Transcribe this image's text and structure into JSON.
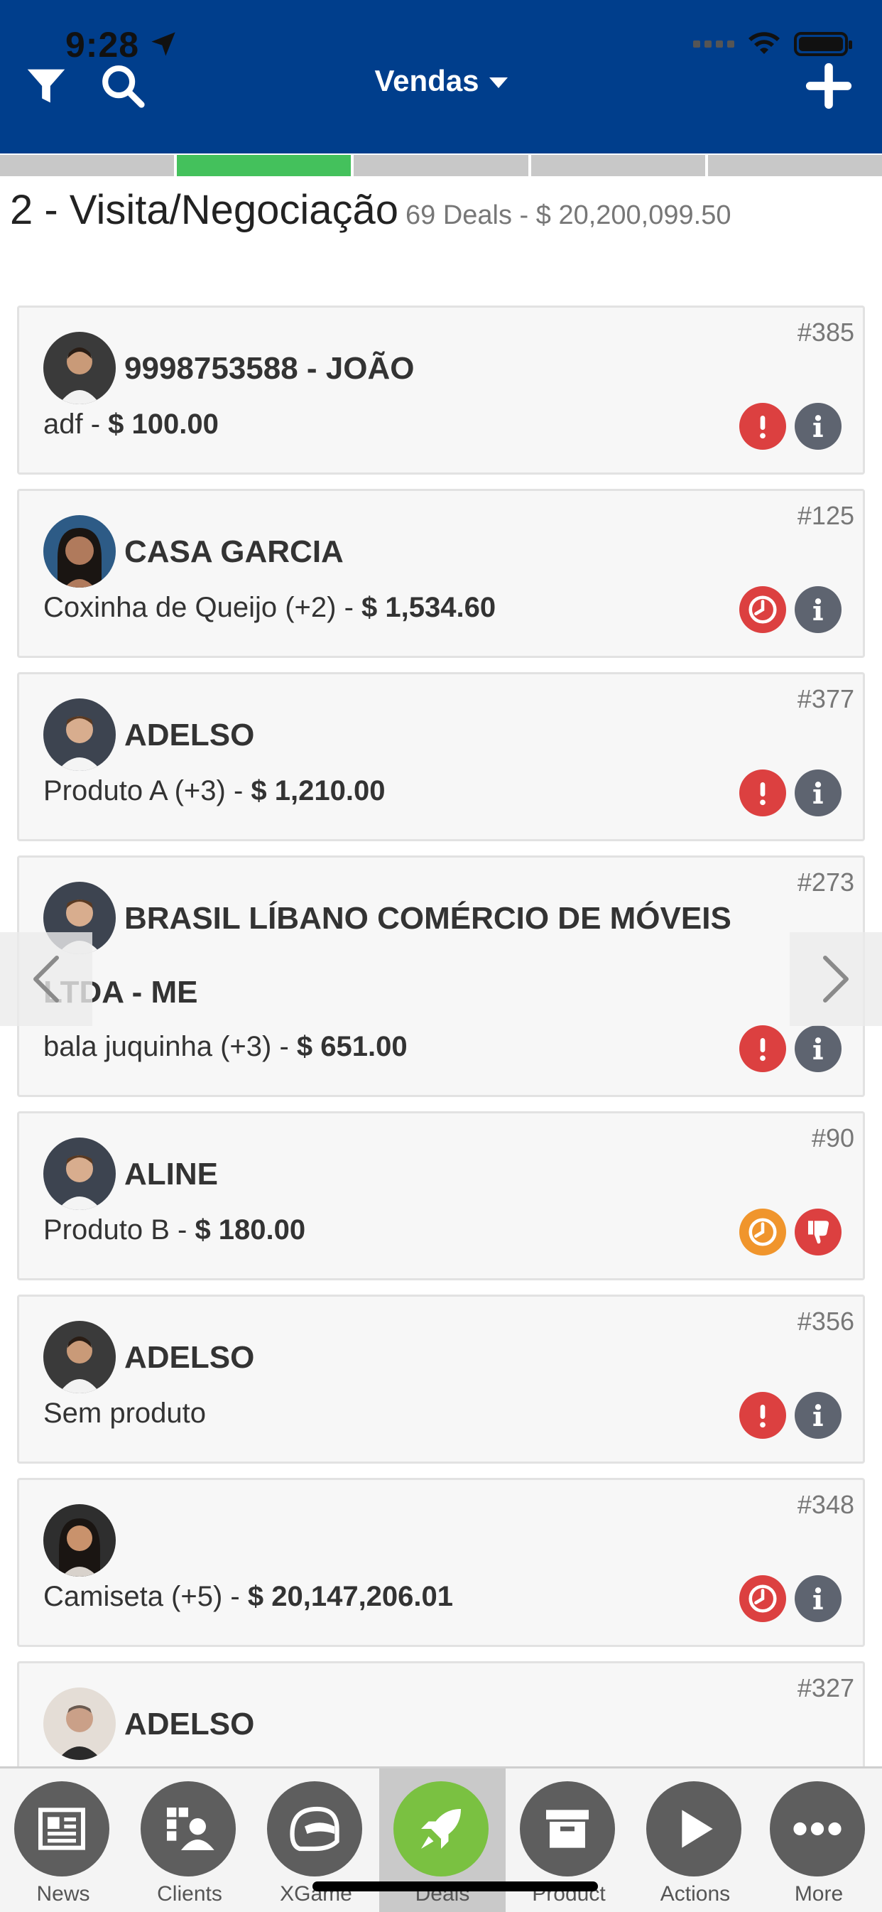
{
  "status_bar": {
    "time": "9:28"
  },
  "header": {
    "title": "Vendas",
    "colors": {
      "background": "#003e8c",
      "text": "#ffffff"
    }
  },
  "stages": {
    "count": 5,
    "active_index": 1,
    "active_color": "#44c15c"
  },
  "stage_header": {
    "title": "2 - Visita/Negociação",
    "summary": "69 Deals - $ 20,200,099.50"
  },
  "deals": [
    {
      "number": "#385",
      "client": "9998753588 - JOÃO",
      "product": "adf - ",
      "amount": "$ 100.00",
      "status_icons": [
        "alert-icon",
        "info-icon"
      ]
    },
    {
      "number": "#125",
      "client": "CASA GARCIA",
      "product": "Coxinha de Queijo (+2) - ",
      "amount": "$ 1,534.60",
      "status_icons": [
        "clock-icon",
        "info-icon"
      ]
    },
    {
      "number": "#377",
      "client": "ADELSO",
      "product": "Produto A (+3) - ",
      "amount": "$ 1,210.00",
      "status_icons": [
        "alert-icon",
        "info-icon"
      ]
    },
    {
      "number": "#273",
      "client": "BRASIL LÍBANO COMÉRCIO DE MÓVEIS LTDA - ME",
      "product": "bala juquinha (+3) - ",
      "amount": "$ 651.00",
      "status_icons": [
        "alert-icon",
        "info-icon"
      ]
    },
    {
      "number": "#90",
      "client": "ALINE",
      "product": "Produto B - ",
      "amount": "$ 180.00",
      "status_icons": [
        "clock-icon",
        "thumbs-down-icon"
      ]
    },
    {
      "number": "#356",
      "client": "ADELSO",
      "product": "Sem produto",
      "amount": "",
      "status_icons": [
        "alert-icon",
        "info-icon"
      ]
    },
    {
      "number": "#348",
      "client": "",
      "product": "Camiseta (+5) - ",
      "amount": "$ 20,147,206.01",
      "status_icons": [
        "clock-icon",
        "info-icon"
      ]
    },
    {
      "number": "#327",
      "client": "ADELSO",
      "product": "",
      "amount": "",
      "status_icons": []
    }
  ],
  "tabs": [
    {
      "label": "News",
      "icon": "newspaper-icon"
    },
    {
      "label": "Clients",
      "icon": "clients-icon"
    },
    {
      "label": "XGame",
      "icon": "helmet-icon"
    },
    {
      "label": "Deals",
      "icon": "rocket-icon",
      "active": true
    },
    {
      "label": "Product",
      "icon": "box-icon"
    },
    {
      "label": "Actions",
      "icon": "play-icon"
    },
    {
      "label": "More",
      "icon": "more-icon"
    }
  ]
}
